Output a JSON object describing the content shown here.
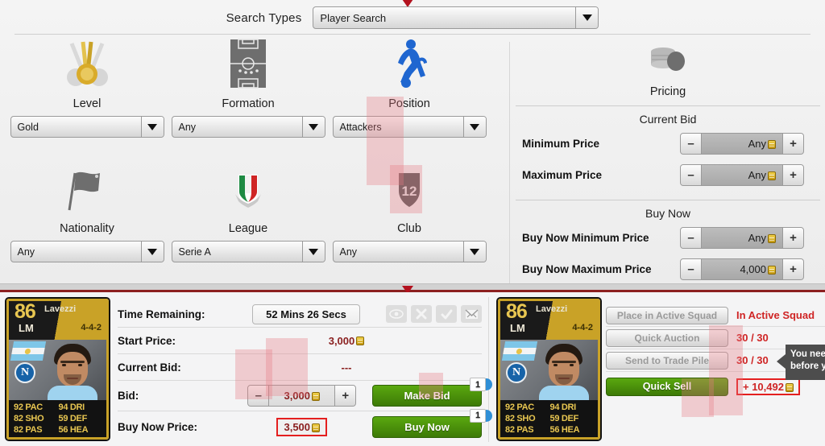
{
  "header": {
    "search_types_label": "Search Types",
    "search_type_value": "Player Search"
  },
  "filters": [
    {
      "icon": "medals-icon",
      "label": "Level",
      "value": "Gold"
    },
    {
      "icon": "pitch-icon",
      "label": "Formation",
      "value": "Any"
    },
    {
      "icon": "player-icon",
      "label": "Position",
      "value": "Attackers"
    },
    {
      "icon": "flag-icon",
      "label": "Nationality",
      "value": "Any"
    },
    {
      "icon": "shield-italy-icon",
      "label": "League",
      "value": "Serie A"
    },
    {
      "icon": "club-crest-icon",
      "label": "Club",
      "value": "Any"
    }
  ],
  "pricing": {
    "icon": "coins-stack-icon",
    "title": "Pricing",
    "current_bid_title": "Current Bid",
    "buy_now_title": "Buy Now",
    "minus_label": "–",
    "plus_label": "+",
    "rows": [
      {
        "label": "Minimum Price",
        "value": "Any"
      },
      {
        "label": "Maximum Price",
        "value": "Any"
      },
      {
        "label": "Buy Now Minimum Price",
        "value": "Any"
      },
      {
        "label": "Buy Now Maximum Price",
        "value": "4,000"
      }
    ]
  },
  "player_card": {
    "rating": "86",
    "name": "Lavezzi",
    "position": "LM",
    "formation": "4-4-2",
    "club_initial": "N",
    "stats": [
      "92 PAC",
      "94 DRI",
      "82 SHO",
      "59 DEF",
      "82 PAS",
      "56 HEA"
    ]
  },
  "auction": {
    "time_remaining_label": "Time Remaining:",
    "time_remaining_value": "52 Mins 26 Secs",
    "start_price_label": "Start Price:",
    "start_price_value": "3,000",
    "current_bid_label": "Current Bid:",
    "current_bid_value": "---",
    "bid_label": "Bid:",
    "bid_value": "3,000",
    "buy_now_price_label": "Buy Now Price:",
    "buy_now_price_value": "3,500",
    "make_bid_label": "Make Bid",
    "buy_now_label": "Buy Now",
    "make_bid_badge": "1",
    "buy_now_badge": "1",
    "minus_label": "–",
    "plus_label": "+",
    "icons": [
      "eye-icon",
      "x-icon",
      "check-icon",
      "envelope-icon"
    ]
  },
  "actions": {
    "rows": [
      {
        "button": "Place in Active Squad",
        "status": "In Active Squad"
      },
      {
        "button": "Quick Auction",
        "status": "30 / 30"
      },
      {
        "button": "Send to Trade Pile",
        "status": "30 / 30"
      }
    ],
    "quick_sell_label": "Quick Sell",
    "quick_sell_amount": "+ 10,492"
  },
  "tooltip": {
    "line1": "You nee",
    "line2": "before y"
  },
  "colors": {
    "accent_red": "#cf2525",
    "highlight_red_border": "#e41f1f",
    "green_button": "#4f9a0d",
    "card_gold": "#c9a227",
    "separator_red": "#8c2020"
  }
}
